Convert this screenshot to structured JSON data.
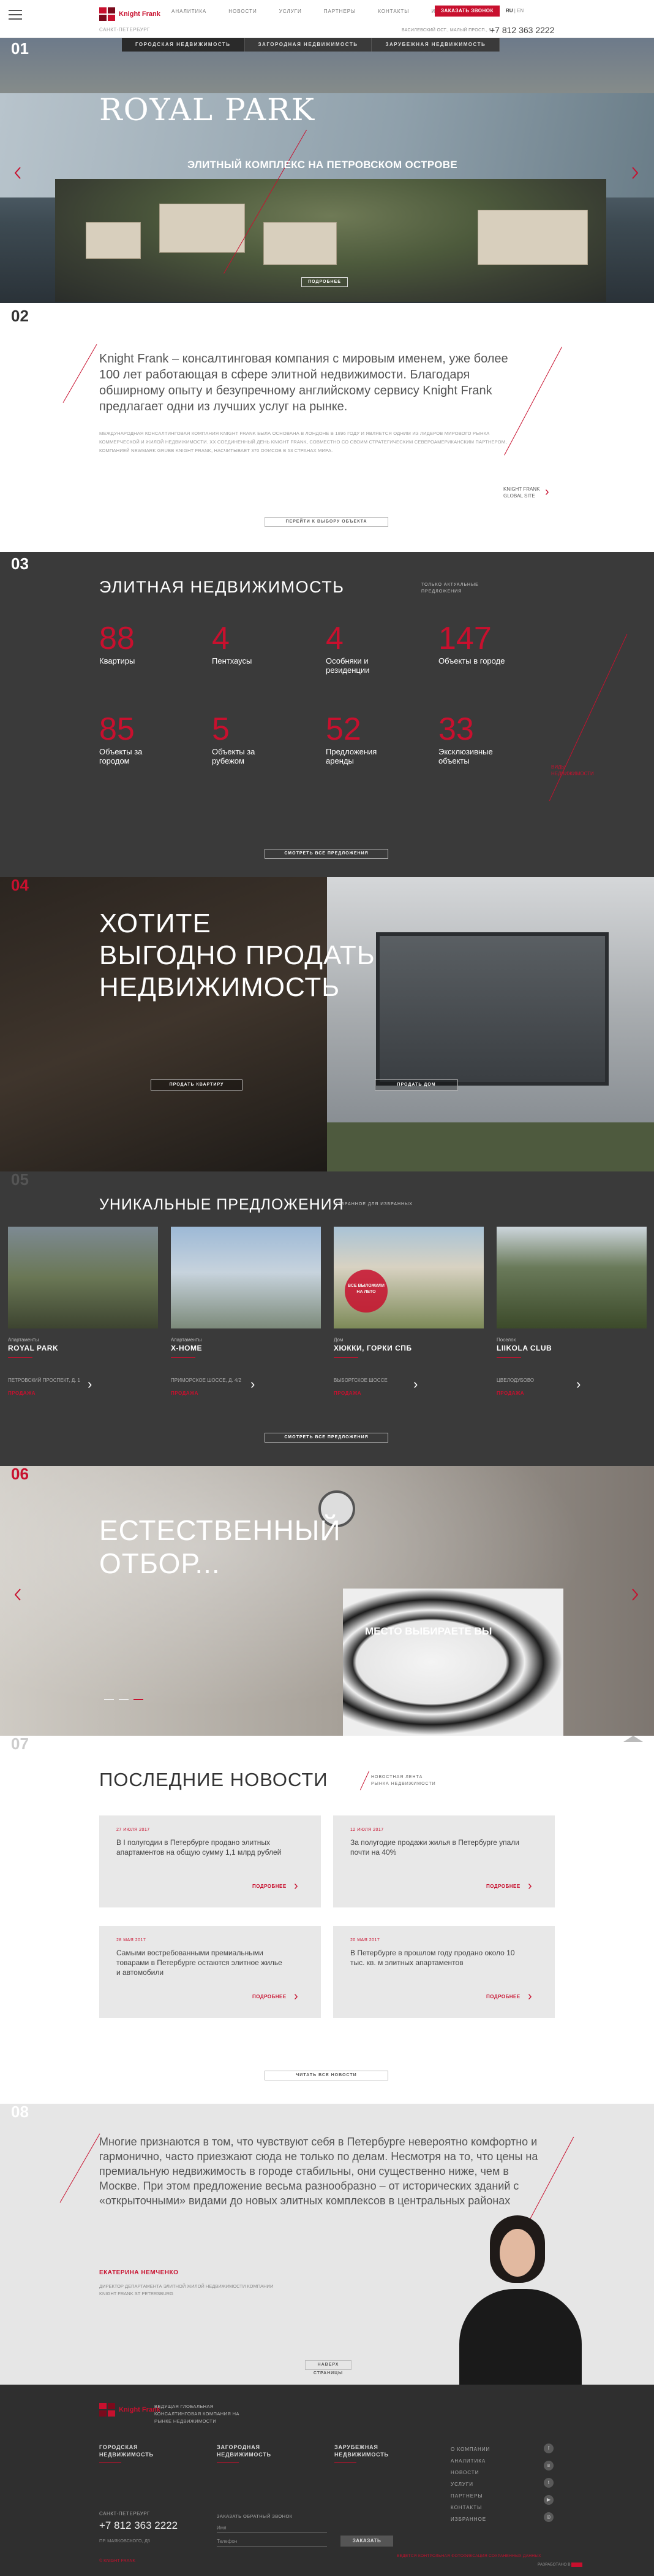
{
  "header": {
    "logo": "Knight Frank",
    "logo_sub": "САНКТ-ПЕТЕРБУРГ",
    "nav": [
      "АНАЛИТИКА",
      "НОВОСТИ",
      "УСЛУГИ",
      "ПАРТНЕРЫ",
      "КОНТАКТЫ",
      "ИЗБРАННОЕ"
    ],
    "call_button": "ЗАКАЗАТЬ ЗВОНОК",
    "lang_ru": "RU",
    "lang_en": "EN",
    "address": "ВАСИЛЕВСКИЙ ОСТ., МАЛЫЙ ПРОСП., 9А",
    "phone": "+7 812 363 2222"
  },
  "hero": {
    "num": "01",
    "tabs": [
      "ГОРОДСКАЯ НЕДВИЖИМОСТЬ",
      "ЗАГОРОДНАЯ НЕДВИЖИМОСТЬ",
      "ЗАРУБЕЖНАЯ НЕДВИЖИМОСТЬ"
    ],
    "title": "ROYAL PARK",
    "subtitle": "ЭЛИТНЫЙ КОМПЛЕКС НА ПЕТРОВСКОМ ОСТРОВЕ",
    "button": "ПОДРОБНЕЕ"
  },
  "about": {
    "num": "02",
    "quote": "Knight Frank – консалтинговая компания с мировым именем, уже более 100 лет работающая в сфере элитной недвижимости. Благодаря обширному опыту и безупречному английскому сервису Knight Frank предлагает одни из лучших услуг на рынке.",
    "text": "МЕЖДУНАРОДНАЯ КОНСАЛТИНГОВАЯ КОМПАНИЯ KNIGHT FRANK БЫЛА ОСНОВАНА В ЛОНДОНЕ В 1896 ГОДУ И ЯВЛЯЕТСЯ ОДНИМ ИЗ ЛИДЕРОВ МИРОВОГО РЫНКА КОММЕРЧЕСКОЙ И ЖИЛОЙ НЕДВИЖИМОСТИ. ХХ СОЕДИНЕННЫЙ ДЕНЬ KNIGHT FRANK, СОВМЕСТНО СО СВОИМ СТРАТЕГИЧЕСКИМ СЕВЕРОАМЕРИКАНСКИМ ПАРТНЕРОМ, КОМПАНИЕЙ NEWMARK GRUBB KNIGHT FRANK, НАСЧИТЫВАЕТ 370 ОФИСОВ В 53 СТРАНАХ МИРА.",
    "site_link": "KNIGHT FRANK\nGLOBAL SITE",
    "button": "ПЕРЕЙТИ К ВЫБОРУ ОБЪЕКТА"
  },
  "elite": {
    "num": "03",
    "title": "ЭЛИТНАЯ НЕДВИЖИМОСТЬ",
    "tag": "ТОЛЬКО АКТУАЛЬНЫЕ\nПРЕДЛОЖЕНИЯ",
    "stats": [
      {
        "n": "88",
        "l": "Квартиры"
      },
      {
        "n": "4",
        "l": "Пентхаусы"
      },
      {
        "n": "4",
        "l": "Особняки и\nрезиденции"
      },
      {
        "n": "147",
        "l": "Объекты в городе"
      },
      {
        "n": "85",
        "l": "Объекты за\nгородом"
      },
      {
        "n": "5",
        "l": "Объекты за\nрубежом"
      },
      {
        "n": "52",
        "l": "Предложения\nаренды"
      },
      {
        "n": "33",
        "l": "Эксклюзивные\nобъекты"
      }
    ],
    "other_link": "ВИДЫ\nНЕДВИЖИМОСТИ",
    "button": "СМОТРЕТЬ ВСЕ ПРЕДЛОЖЕНИЯ"
  },
  "sell": {
    "num": "04",
    "title": "ХОТИТЕ\nВЫГОДНО ПРОДАТЬ\nНЕДВИЖИМОСТЬ",
    "button_left": "ПРОДАТЬ КВАРТИРУ",
    "button_right": "ПРОДАТЬ ДОМ"
  },
  "unique": {
    "num": "05",
    "title": "УНИКАЛЬНЫЕ ПРЕДЛОЖЕНИЯ",
    "tag": "ИЗБРАННОЕ ДЛЯ ИЗБРАННЫХ",
    "cards": [
      {
        "type": "Апартаменты",
        "name": "ROYAL PARK",
        "addr": "ПЕТРОВСКИЙ ПРОСПЕКТ, Д. 1",
        "price": "ПРОДАЖА"
      },
      {
        "type": "Апартаменты",
        "name": "X-HOME",
        "addr": "ПРИМОРСКОЕ ШОССЕ, Д. 4/2",
        "price": "ПРОДАЖА"
      },
      {
        "type": "Дом",
        "name": "ХЮККИ, ГОРКИ СПБ",
        "addr": "ВЫБОРГСКОЕ ШОССЕ",
        "price": "ПРОДАЖА",
        "badge": "ВСЕ ВЫЛОЖИЛИ НА ЛЕТО"
      },
      {
        "type": "Поселок",
        "name": "LIIKOLA CLUB",
        "addr": "ЦВЕЛОДУБОВО",
        "price": "ПРОДАЖА"
      }
    ],
    "button": "СМОТРЕТЬ ВСЕ ПРЕДЛОЖЕНИЯ"
  },
  "natural": {
    "num": "06",
    "title": "ЕСТЕСТВЕННЫЙ\nОТБОР...",
    "subtitle": "МЕСТО ВЫБИРАЕТЕ ВЫ"
  },
  "news": {
    "num": "07",
    "title": "ПОСЛЕДНИЕ НОВОСТИ",
    "tag": "НОВОСТНАЯ ЛЕНТА\nРЫНКА НЕДВИЖИМОСТИ",
    "items": [
      {
        "date": "27 ИЮЛЯ 2017",
        "text": "В I полугодии в Петербурге продано элитных апартаментов на общую сумму 1,1 млрд рублей",
        "more": "ПОДРОБНЕЕ"
      },
      {
        "date": "12 ИЮЛЯ 2017",
        "text": "За полугодие продажи жилья в Петербурге упали почти на 40%",
        "more": "ПОДРОБНЕЕ"
      },
      {
        "date": "28 МАЯ 2017",
        "text": "Самыми востребованными премиальными товарами в Петербурге остаются элитное жилье и автомобили",
        "more": "ПОДРОБНЕЕ"
      },
      {
        "date": "20 МАЯ 2017",
        "text": "В Петербурге в прошлом году продано около 10 тыс. кв. м элитных апартаментов",
        "more": "ПОДРОБНЕЕ"
      }
    ],
    "button": "ЧИТАТЬ ВСЕ НОВОСТИ"
  },
  "quote": {
    "num": "08",
    "text": "Многие признаются в том, что чувствуют себя в Петербурге невероятно комфортно и гармонично, часто приезжают сюда не только по делам. Несмотря на то, что цены на премиальную недвижимость в городе стабильны, они существенно ниже, чем в Москве. При этом предложение весьма разнообразно – от исторических зданий с «открыточными» видами до новых элитных комплексов в центральных районах",
    "name": "ЕКАТЕРИНА НЕМЧЕНКО",
    "position": "ДИРЕКТОР ДЕПАРТАМЕНТА ЭЛИТНОЙ ЖИЛОЙ НЕДВИЖИМОСТИ КОМПАНИИ KNIGHT FRANK ST PETERSBURG",
    "button": "НАВЕРХ СТРАНИЦЫ"
  },
  "footer": {
    "logo": "Knight Frank",
    "tagline": "ВЕДУЩАЯ ГЛОБАЛЬНАЯ КОНСАЛТИНГОВАЯ КОМПАНИЯ НА РЫНКЕ НЕДВИЖИМОСТИ",
    "cols": [
      "ГОРОДСКАЯ\nНЕДВИЖИМОСТЬ",
      "ЗАГОРОДНАЯ\nНЕДВИЖИМОСТЬ",
      "ЗАРУБЕЖНАЯ\nНЕДВИЖИМОСТЬ"
    ],
    "menu": [
      "О КОМПАНИИ",
      "АНАЛИТИКА",
      "НОВОСТИ",
      "УСЛУГИ",
      "ПАРТНЕРЫ",
      "КОНТАКТЫ",
      "ИЗБРАННОЕ"
    ],
    "city": "САНКТ-ПЕТЕРБУРГ",
    "phone": "+7 812 363 2222",
    "address": "ПР. МАЯКОВСКОГО, Д5",
    "callback_label": "ЗАКАЗАТЬ ОБРАТНЫЙ ЗВОНОК",
    "name_placeholder": "Имя",
    "phone_placeholder": "Телефон",
    "submit": "ЗАКАЗАТЬ",
    "copyright": "© KNIGHT FRANK",
    "policy": "ВЕДЕТСЯ КОНТРОЛЬНАЯ ФОТОФИКСАЦИЯ СОХРАНЕННЫХ ДАННЫХ",
    "dev": "РАЗРАБОТАНО В"
  }
}
